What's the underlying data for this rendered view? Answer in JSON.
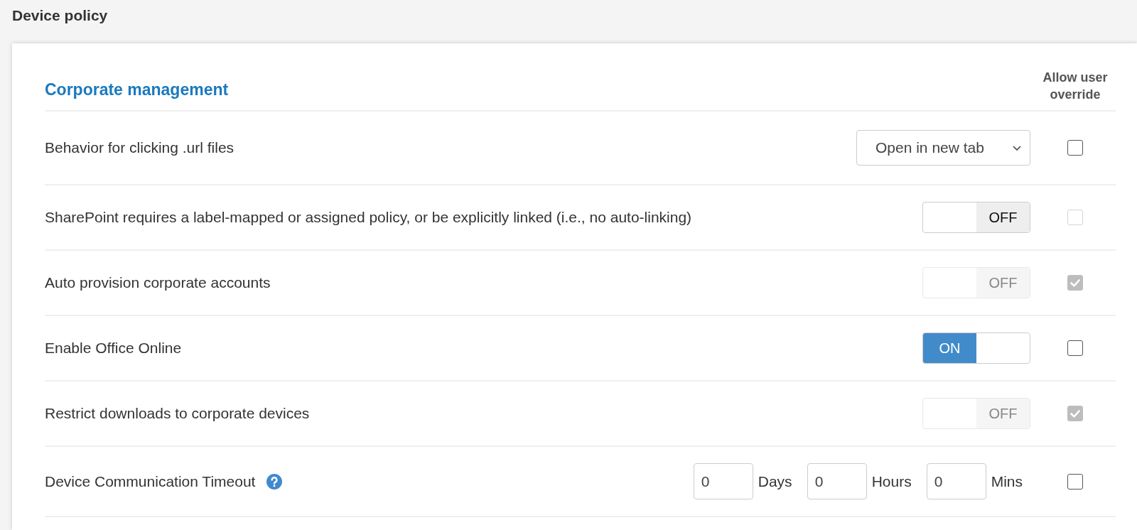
{
  "page": {
    "title": "Device policy"
  },
  "section": {
    "title": "Corporate management",
    "override_header": "Allow user override"
  },
  "settings": [
    {
      "kind": "select",
      "label": "Behavior for clicking .url files",
      "value": "Open in new tab",
      "override": {
        "checked": false,
        "disabled": false
      }
    },
    {
      "kind": "toggle",
      "label": "SharePoint requires a label-mapped or assigned policy, or be explicitly linked (i.e., no auto-linking)",
      "on": false,
      "state_label": "OFF",
      "disabled": false,
      "override": {
        "checked": false,
        "disabled": true
      }
    },
    {
      "kind": "toggle",
      "label": "Auto provision corporate accounts",
      "on": false,
      "state_label": "OFF",
      "disabled": true,
      "override": {
        "checked": true,
        "disabled": true
      }
    },
    {
      "kind": "toggle",
      "label": "Enable Office Online",
      "on": true,
      "state_label": "ON",
      "disabled": false,
      "override": {
        "checked": false,
        "disabled": false
      }
    },
    {
      "kind": "toggle",
      "label": "Restrict downloads to corporate devices",
      "on": false,
      "state_label": "OFF",
      "disabled": true,
      "override": {
        "checked": true,
        "disabled": true
      }
    },
    {
      "kind": "duration",
      "label": "Device Communication Timeout",
      "help": true,
      "fields": [
        {
          "value": "0",
          "unit": "Days"
        },
        {
          "value": "0",
          "unit": "Hours"
        },
        {
          "value": "0",
          "unit": "Mins"
        }
      ],
      "override": {
        "checked": false,
        "disabled": false
      }
    }
  ]
}
